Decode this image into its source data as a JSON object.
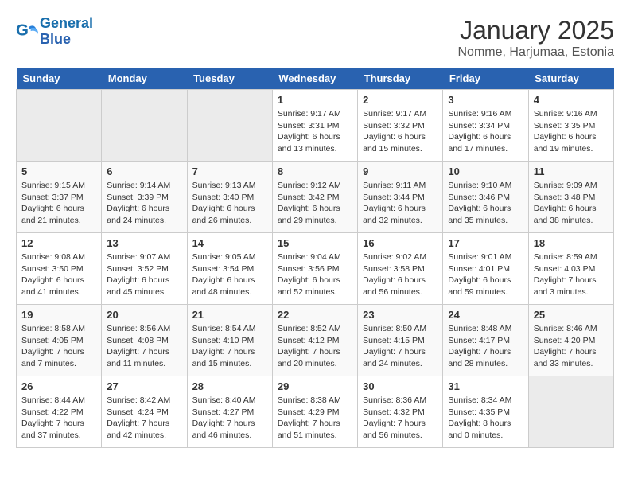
{
  "header": {
    "logo_line1": "General",
    "logo_line2": "Blue",
    "month": "January 2025",
    "location": "Nomme, Harjumaa, Estonia"
  },
  "weekdays": [
    "Sunday",
    "Monday",
    "Tuesday",
    "Wednesday",
    "Thursday",
    "Friday",
    "Saturday"
  ],
  "weeks": [
    [
      {
        "day": "",
        "info": ""
      },
      {
        "day": "",
        "info": ""
      },
      {
        "day": "",
        "info": ""
      },
      {
        "day": "1",
        "info": "Sunrise: 9:17 AM\nSunset: 3:31 PM\nDaylight: 6 hours\nand 13 minutes."
      },
      {
        "day": "2",
        "info": "Sunrise: 9:17 AM\nSunset: 3:32 PM\nDaylight: 6 hours\nand 15 minutes."
      },
      {
        "day": "3",
        "info": "Sunrise: 9:16 AM\nSunset: 3:34 PM\nDaylight: 6 hours\nand 17 minutes."
      },
      {
        "day": "4",
        "info": "Sunrise: 9:16 AM\nSunset: 3:35 PM\nDaylight: 6 hours\nand 19 minutes."
      }
    ],
    [
      {
        "day": "5",
        "info": "Sunrise: 9:15 AM\nSunset: 3:37 PM\nDaylight: 6 hours\nand 21 minutes."
      },
      {
        "day": "6",
        "info": "Sunrise: 9:14 AM\nSunset: 3:39 PM\nDaylight: 6 hours\nand 24 minutes."
      },
      {
        "day": "7",
        "info": "Sunrise: 9:13 AM\nSunset: 3:40 PM\nDaylight: 6 hours\nand 26 minutes."
      },
      {
        "day": "8",
        "info": "Sunrise: 9:12 AM\nSunset: 3:42 PM\nDaylight: 6 hours\nand 29 minutes."
      },
      {
        "day": "9",
        "info": "Sunrise: 9:11 AM\nSunset: 3:44 PM\nDaylight: 6 hours\nand 32 minutes."
      },
      {
        "day": "10",
        "info": "Sunrise: 9:10 AM\nSunset: 3:46 PM\nDaylight: 6 hours\nand 35 minutes."
      },
      {
        "day": "11",
        "info": "Sunrise: 9:09 AM\nSunset: 3:48 PM\nDaylight: 6 hours\nand 38 minutes."
      }
    ],
    [
      {
        "day": "12",
        "info": "Sunrise: 9:08 AM\nSunset: 3:50 PM\nDaylight: 6 hours\nand 41 minutes."
      },
      {
        "day": "13",
        "info": "Sunrise: 9:07 AM\nSunset: 3:52 PM\nDaylight: 6 hours\nand 45 minutes."
      },
      {
        "day": "14",
        "info": "Sunrise: 9:05 AM\nSunset: 3:54 PM\nDaylight: 6 hours\nand 48 minutes."
      },
      {
        "day": "15",
        "info": "Sunrise: 9:04 AM\nSunset: 3:56 PM\nDaylight: 6 hours\nand 52 minutes."
      },
      {
        "day": "16",
        "info": "Sunrise: 9:02 AM\nSunset: 3:58 PM\nDaylight: 6 hours\nand 56 minutes."
      },
      {
        "day": "17",
        "info": "Sunrise: 9:01 AM\nSunset: 4:01 PM\nDaylight: 6 hours\nand 59 minutes."
      },
      {
        "day": "18",
        "info": "Sunrise: 8:59 AM\nSunset: 4:03 PM\nDaylight: 7 hours\nand 3 minutes."
      }
    ],
    [
      {
        "day": "19",
        "info": "Sunrise: 8:58 AM\nSunset: 4:05 PM\nDaylight: 7 hours\nand 7 minutes."
      },
      {
        "day": "20",
        "info": "Sunrise: 8:56 AM\nSunset: 4:08 PM\nDaylight: 7 hours\nand 11 minutes."
      },
      {
        "day": "21",
        "info": "Sunrise: 8:54 AM\nSunset: 4:10 PM\nDaylight: 7 hours\nand 15 minutes."
      },
      {
        "day": "22",
        "info": "Sunrise: 8:52 AM\nSunset: 4:12 PM\nDaylight: 7 hours\nand 20 minutes."
      },
      {
        "day": "23",
        "info": "Sunrise: 8:50 AM\nSunset: 4:15 PM\nDaylight: 7 hours\nand 24 minutes."
      },
      {
        "day": "24",
        "info": "Sunrise: 8:48 AM\nSunset: 4:17 PM\nDaylight: 7 hours\nand 28 minutes."
      },
      {
        "day": "25",
        "info": "Sunrise: 8:46 AM\nSunset: 4:20 PM\nDaylight: 7 hours\nand 33 minutes."
      }
    ],
    [
      {
        "day": "26",
        "info": "Sunrise: 8:44 AM\nSunset: 4:22 PM\nDaylight: 7 hours\nand 37 minutes."
      },
      {
        "day": "27",
        "info": "Sunrise: 8:42 AM\nSunset: 4:24 PM\nDaylight: 7 hours\nand 42 minutes."
      },
      {
        "day": "28",
        "info": "Sunrise: 8:40 AM\nSunset: 4:27 PM\nDaylight: 7 hours\nand 46 minutes."
      },
      {
        "day": "29",
        "info": "Sunrise: 8:38 AM\nSunset: 4:29 PM\nDaylight: 7 hours\nand 51 minutes."
      },
      {
        "day": "30",
        "info": "Sunrise: 8:36 AM\nSunset: 4:32 PM\nDaylight: 7 hours\nand 56 minutes."
      },
      {
        "day": "31",
        "info": "Sunrise: 8:34 AM\nSunset: 4:35 PM\nDaylight: 8 hours\nand 0 minutes."
      },
      {
        "day": "",
        "info": ""
      }
    ]
  ]
}
